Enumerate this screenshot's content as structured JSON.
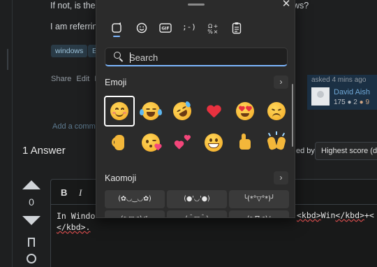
{
  "background_page": {
    "question_line1": "If not, is there",
    "question_line1_right": "ws?",
    "question_line2": "I am referring",
    "tags": [
      "windows",
      "E"
    ],
    "post_menu": [
      "Share",
      "Edit",
      "Fo"
    ],
    "owner": {
      "asked": "asked 4 mins ago",
      "username": "David Aish",
      "reputation": "175",
      "silver": "● 2",
      "bronze": "● 9"
    },
    "add_comment": "Add a comme",
    "answers_heading": "1 Answer",
    "sort_label": "ed by:",
    "sort_value": "Highest score (de",
    "vote_count": "0",
    "editor": {
      "bold": "B",
      "italic": "I",
      "line1_start": "In Windo",
      "line1_end_parts": [
        "<kbd>",
        "Win",
        "</kbd>",
        "+<"
      ],
      "line2": "</kbd>."
    }
  },
  "emoji_panel": {
    "close": "✕",
    "tabs": [
      {
        "name": "tab-emoji",
        "glyph": "♥",
        "active": true
      },
      {
        "name": "tab-gif-smiley",
        "glyph": "☺",
        "active": false
      },
      {
        "name": "tab-gif",
        "glyph": "GIF",
        "active": false
      },
      {
        "name": "tab-kaomoji",
        "glyph": ";-)",
        "active": false
      },
      {
        "name": "tab-symbols",
        "glyph": "Ω",
        "active": false
      },
      {
        "name": "tab-clipboard",
        "glyph": "▤",
        "active": false
      }
    ],
    "search_placeholder": "Search",
    "emoji_section": {
      "title": "Emoji",
      "more": "›",
      "items": [
        "smiling-face",
        "tears-of-joy-face",
        "rofl-face",
        "red-heart",
        "heart-eyes-face",
        "pensive-face",
        "ok-hand",
        "kissing-heart-face",
        "two-hearts",
        "grinning-face",
        "thumbs-up",
        "raising-hands"
      ]
    },
    "kaomoji_section": {
      "title": "Kaomoji",
      "more": "›",
      "items": [
        "(✿◡‿◡✿)",
        "(●'◡'●)",
        "╰(*°▽°*)╯",
        "(≧▽≦)ゞ",
        "(＾▽＾)",
        "(≧∇≦)ﾉ"
      ]
    }
  }
}
